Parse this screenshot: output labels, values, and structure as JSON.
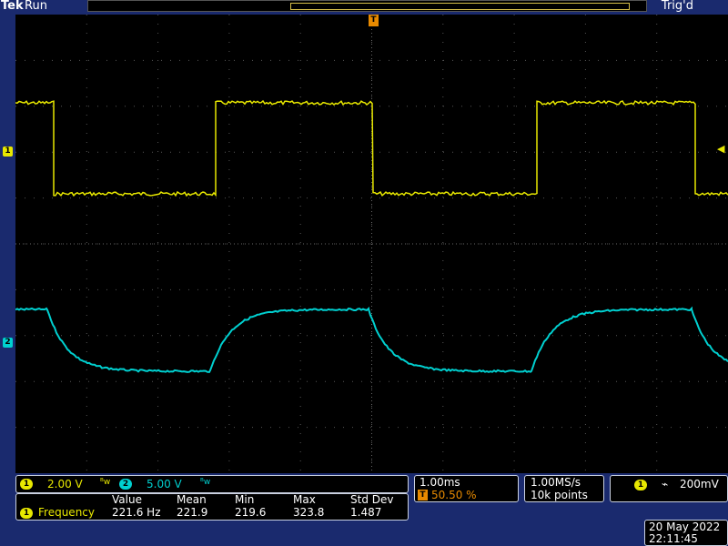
{
  "header": {
    "brand": "Tek",
    "status": "Run",
    "trigger_status": "Trig'd"
  },
  "channels": {
    "ch1": {
      "label": "1",
      "scale": "2.00 V",
      "coupling_icon": "bandwidth-icon",
      "color": "#e8e800"
    },
    "ch2": {
      "label": "2",
      "scale": "5.00 V",
      "coupling_icon": "bandwidth-icon",
      "color": "#00d0d0"
    }
  },
  "trigger_marker": "T",
  "horizontal": {
    "timebase": "1.00ms",
    "trigger_position": "50.50 %"
  },
  "acquisition": {
    "sample_rate": "1.00MS/s",
    "record_length": "10k points"
  },
  "trigger": {
    "source": "1",
    "slope_icon": "falling-edge-icon",
    "level": "200mV"
  },
  "measurements": {
    "headers": [
      "Value",
      "Mean",
      "Min",
      "Max",
      "Std Dev"
    ],
    "rows": [
      {
        "source": "1",
        "name": "Frequency",
        "value": "221.6 Hz",
        "mean": "221.9",
        "min": "219.6",
        "max": "323.8",
        "std_dev": "1.487"
      }
    ]
  },
  "datetime": {
    "date": "20 May 2022",
    "time": "22:11:45"
  }
}
